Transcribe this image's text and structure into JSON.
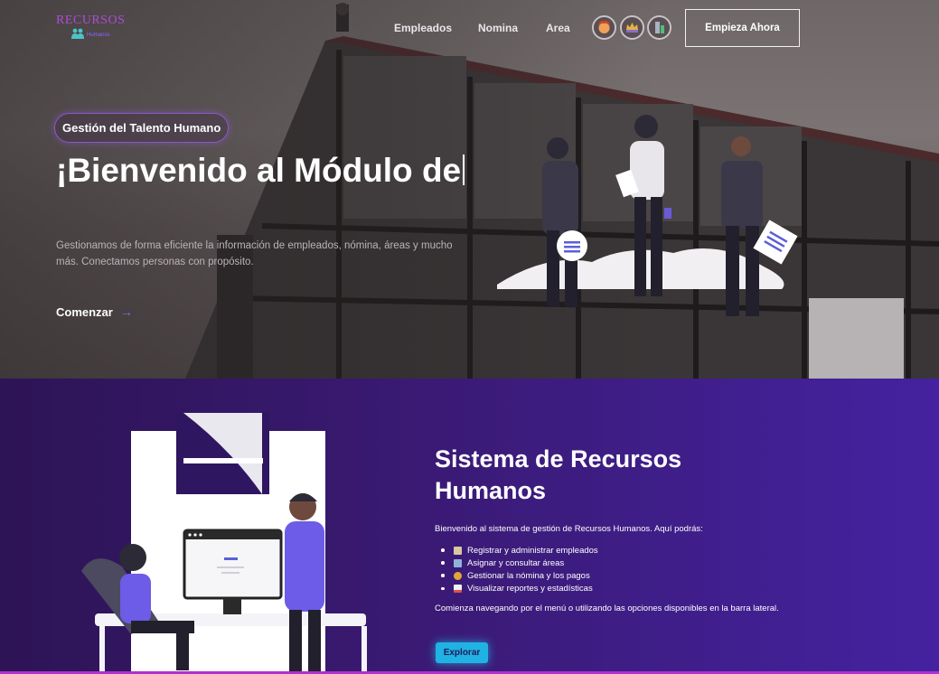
{
  "nav": {
    "logo_text": "RECURSOS",
    "logo_sub": "Humanos",
    "links": [
      "Empleados",
      "Nomina",
      "Area"
    ],
    "cta_label": "Empieza Ahora"
  },
  "hero": {
    "badge": "Gestión del Talento Humano",
    "title": "¡Bienvenido al Módulo de",
    "description": "Gestionamos de forma eficiente la información de empleados, nómina, áreas y mucho más. Conectamos personas con propósito.",
    "link_label": "Comenzar",
    "link_arrow": "→"
  },
  "section": {
    "title": "Sistema de Recursos Humanos",
    "intro": "Bienvenido al sistema de gestión de Recursos Humanos. Aquí podrás:",
    "features": [
      {
        "label": "Registrar y administrar empleados",
        "icon": "clipboard-icon"
      },
      {
        "label": "Asignar y consultar áreas",
        "icon": "office-icon"
      },
      {
        "label": "Gestionar la nómina y los pagos",
        "icon": "money-bag-icon"
      },
      {
        "label": "Visualizar reportes y estadísticas",
        "icon": "chart-icon"
      }
    ],
    "footer": "Comienza navegando por el menú o utilizando las opciones disponibles en la barra lateral.",
    "button_label": "Explorar"
  },
  "colors": {
    "accent": "#b22fd0",
    "button": "#1fb2e3",
    "section_bg": "#3a1a74"
  }
}
